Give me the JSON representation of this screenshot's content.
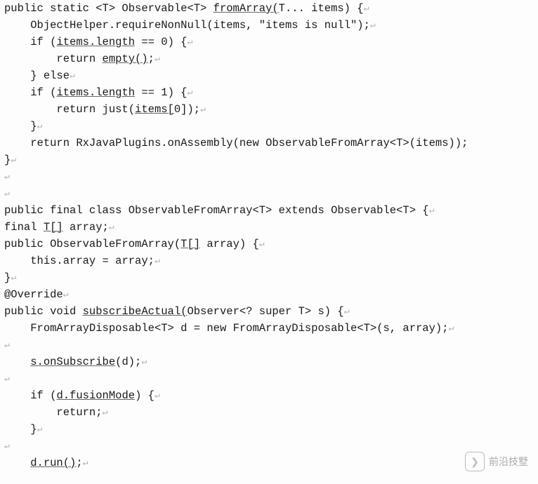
{
  "code": {
    "lines": [
      {
        "indent": 0,
        "segments": [
          {
            "t": "public static <T> Observable<T> "
          },
          {
            "t": "fromArray(",
            "u": true
          },
          {
            "t": "T... items) {"
          }
        ],
        "nl": true
      },
      {
        "indent": 1,
        "segments": [
          {
            "t": "ObjectHelper.requireNonNull(items, \"items is null\");"
          }
        ],
        "nl": true
      },
      {
        "indent": 1,
        "segments": [
          {
            "t": "if ("
          },
          {
            "t": "items.length",
            "u": true
          },
          {
            "t": " == 0) {"
          }
        ],
        "nl": true
      },
      {
        "indent": 2,
        "segments": [
          {
            "t": "return "
          },
          {
            "t": "empty()",
            "u": true
          },
          {
            "t": ";"
          }
        ],
        "nl": true
      },
      {
        "indent": 1,
        "segments": [
          {
            "t": "} else"
          }
        ],
        "nl": true
      },
      {
        "indent": 1,
        "segments": [
          {
            "t": "if ("
          },
          {
            "t": "items.length",
            "u": true
          },
          {
            "t": " == 1) {"
          }
        ],
        "nl": true
      },
      {
        "indent": 2,
        "segments": [
          {
            "t": "return just("
          },
          {
            "t": "items[",
            "u": true
          },
          {
            "t": "0]);"
          }
        ],
        "nl": true
      },
      {
        "indent": 1,
        "segments": [
          {
            "t": "}"
          }
        ],
        "nl": true
      },
      {
        "indent": 1,
        "segments": [
          {
            "t": "return RxJavaPlugins.onAssembly(new ObservableFromArray<T>(items));"
          }
        ],
        "nl": false
      },
      {
        "indent": 0,
        "segments": [
          {
            "t": "}"
          }
        ],
        "nl": true
      },
      {
        "indent": 0,
        "segments": [],
        "nl": true
      },
      {
        "indent": 0,
        "segments": [],
        "nl": true
      },
      {
        "indent": 0,
        "segments": [
          {
            "t": "public final class ObservableFromArray<T> extends Observable<T> {"
          }
        ],
        "nl": true
      },
      {
        "indent": 0,
        "segments": [
          {
            "t": "final "
          },
          {
            "t": "T[]",
            "u": true
          },
          {
            "t": " array;"
          }
        ],
        "nl": true
      },
      {
        "indent": 0,
        "segments": [
          {
            "t": "public ObservableFromArray("
          },
          {
            "t": "T[]",
            "u": true
          },
          {
            "t": " array) {"
          }
        ],
        "nl": true
      },
      {
        "indent": 1,
        "segments": [
          {
            "t": "this.array = array;"
          }
        ],
        "nl": true
      },
      {
        "indent": 0,
        "segments": [
          {
            "t": "}"
          }
        ],
        "nl": true
      },
      {
        "indent": 0,
        "segments": [
          {
            "t": "@Override"
          }
        ],
        "nl": true
      },
      {
        "indent": 0,
        "segments": [
          {
            "t": "public void "
          },
          {
            "t": "subscribeActual(",
            "u": true
          },
          {
            "t": "Observer<? super T> s) {"
          }
        ],
        "nl": true
      },
      {
        "indent": 1,
        "segments": [
          {
            "t": "FromArrayDisposable<T> d = new FromArrayDisposable<T>(s, array);"
          }
        ],
        "nl": true
      },
      {
        "indent": 0,
        "segments": [],
        "nl": true
      },
      {
        "indent": 1,
        "segments": [
          {
            "t": "s.onSubscribe",
            "u": true
          },
          {
            "t": "(d);"
          }
        ],
        "nl": true
      },
      {
        "indent": 0,
        "segments": [],
        "nl": true
      },
      {
        "indent": 1,
        "segments": [
          {
            "t": "if ("
          },
          {
            "t": "d.fusionMode",
            "u": true
          },
          {
            "t": ") {"
          }
        ],
        "nl": true
      },
      {
        "indent": 2,
        "segments": [
          {
            "t": "return;"
          }
        ],
        "nl": true
      },
      {
        "indent": 1,
        "segments": [
          {
            "t": "}"
          }
        ],
        "nl": true
      },
      {
        "indent": 0,
        "segments": [],
        "nl": true
      },
      {
        "indent": 1,
        "segments": [
          {
            "t": "d.run()",
            "u": true
          },
          {
            "t": ";"
          }
        ],
        "nl": true
      }
    ],
    "indent_unit": "    ",
    "newline_glyph": "↵"
  },
  "watermark": {
    "logo_glyph": "❯",
    "text": "前沿技墅"
  }
}
